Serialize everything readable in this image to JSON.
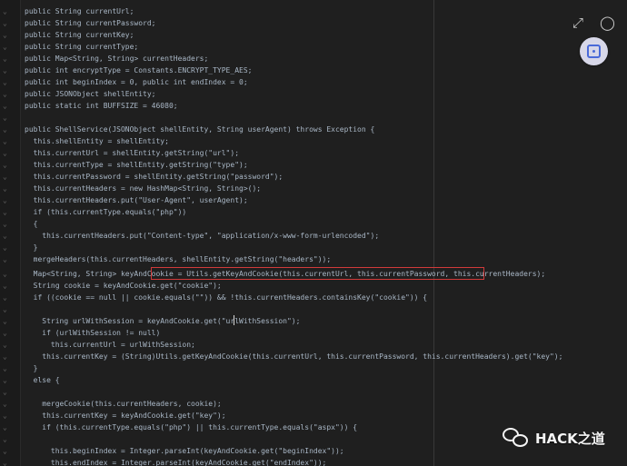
{
  "lines": [
    "public String currentUrl;",
    "public String currentPassword;",
    "public String currentKey;",
    "public String currentType;",
    "public Map<String, String> currentHeaders;",
    "public int encryptType = Constants.ENCRYPT_TYPE_AES;",
    "public int beginIndex = 0, public int endIndex = 0;",
    "public JSONObject shellEntity;",
    "public static int BUFFSIZE = 46080;",
    "",
    "public ShellService(JSONObject shellEntity, String userAgent) throws Exception {",
    "  this.shellEntity = shellEntity;",
    "  this.currentUrl = shellEntity.getString(\"url\");",
    "  this.currentType = shellEntity.getString(\"type\");",
    "  this.currentPassword = shellEntity.getString(\"password\");",
    "  this.currentHeaders = new HashMap<String, String>();",
    "  this.currentHeaders.put(\"User-Agent\", userAgent);",
    "  if (this.currentType.equals(\"php\"))",
    "  {",
    "    this.currentHeaders.put(\"Content-type\", \"application/x-www-form-urlencoded\");",
    "  }",
    "  mergeHeaders(this.currentHeaders, shellEntity.getString(\"headers\"));",
    "  Map<String, String> keyAndCookie = Utils.getKeyAndCookie(this.currentUrl, this.currentPassword, this.currentHeaders);",
    "  String cookie = keyAndCookie.get(\"cookie\");",
    "  if ((cookie == null || cookie.equals(\"\")) && !this.currentHeaders.containsKey(\"cookie\")) {",
    "",
    "    String urlWithSession = keyAndCookie.get(\"urlWithSession\");",
    "    if (urlWithSession != null)",
    "      this.currentUrl = urlWithSession;",
    "    this.currentKey = (String)Utils.getKeyAndCookie(this.currentUrl, this.currentPassword, this.currentHeaders).get(\"key\");",
    "  }",
    "  else {",
    "",
    "    mergeCookie(this.currentHeaders, cookie);",
    "    this.currentKey = keyAndCookie.get(\"key\");",
    "    if (this.currentType.equals(\"php\") || this.currentType.equals(\"aspx\")) {",
    "",
    "      this.beginIndex = Integer.parseInt(keyAndCookie.get(\"beginIndex\"));",
    "      this.endIndex = Integer.parseInt(keyAndCookie.get(\"endIndex\"));"
  ],
  "icons": {
    "expand": "expand-icon",
    "chat": "chat-icon",
    "scan": "scan-icon",
    "wechat": "wechat-icon"
  },
  "watermark": {
    "text": "HACK之道"
  },
  "colors": {
    "background": "#1f1f1f",
    "highlight": "#d13a3a",
    "keyword": "#cc7832",
    "string": "#6a8759",
    "field": "#9876aa"
  }
}
